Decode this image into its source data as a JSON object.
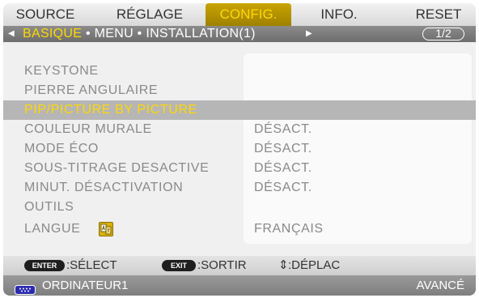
{
  "tabs": [
    {
      "label": "SOURCE",
      "active": false
    },
    {
      "label": "RÉGLAGE",
      "active": false
    },
    {
      "label": "CONFIG.",
      "active": true
    },
    {
      "label": "INFO.",
      "active": false
    },
    {
      "label": "RESET",
      "active": false
    }
  ],
  "subtabs": {
    "active": "BASIQUE",
    "rest": " • MENU • INSTALLATION(1)",
    "separator": " • ",
    "page": "1/2"
  },
  "rows": [
    {
      "label": "KEYSTONE",
      "value": ""
    },
    {
      "label": "PIERRE ANGULAIRE",
      "value": ""
    },
    {
      "label": "PIP/PICTURE BY PICTURE",
      "value": "",
      "selected": true
    },
    {
      "label": "COULEUR MURALE",
      "value": "DÉSACT."
    },
    {
      "label": "MODE ÉCO",
      "value": "DÉSACT."
    },
    {
      "label": "SOUS-TITRAGE DESACTIVE",
      "value": "DÉSACT."
    },
    {
      "label": "MINUT. DÉSACTIVATION",
      "value": "DÉSACT."
    },
    {
      "label": "OUTILS",
      "value": ""
    },
    {
      "label": "LANGUE",
      "value": "FRANÇAIS",
      "icon": "language-icon"
    }
  ],
  "guide": {
    "enter_key": "ENTER",
    "enter_text": ":SÉLECT",
    "exit_key": "EXIT",
    "exit_text": ":SORTIR",
    "move_symbol": "⇕",
    "move_text": ":DÉPLAC"
  },
  "status": {
    "source_icon": "computer-input-icon",
    "source": "ORDINATEUR1",
    "level": "AVANCÉ"
  },
  "colors": {
    "active_tab_text": "#ffd700",
    "selected_text": "#ffd700",
    "selected_row": "#b6b6b6",
    "inactive_text": "#8a8a8a"
  }
}
